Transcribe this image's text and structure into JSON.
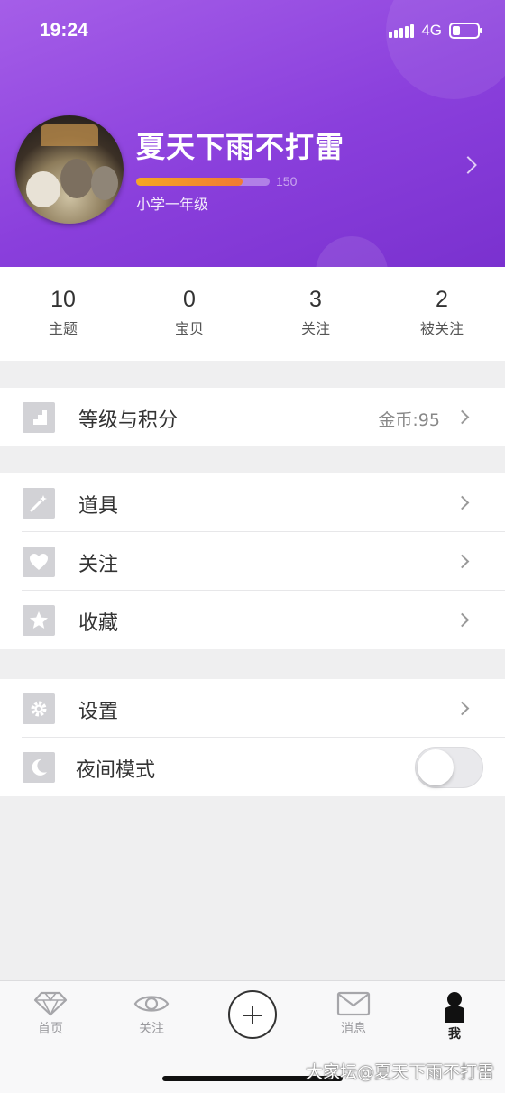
{
  "status_bar": {
    "time": "19:24",
    "network": "4G",
    "battery_level": 0.2
  },
  "profile": {
    "username": "夏天下雨不打雷",
    "level_max": "150",
    "level_progress": 0.8,
    "level_title": "小学一年级"
  },
  "stats": [
    {
      "value": "10",
      "label": "主题"
    },
    {
      "value": "0",
      "label": "宝贝"
    },
    {
      "value": "3",
      "label": "关注"
    },
    {
      "value": "2",
      "label": "被关注"
    }
  ],
  "menu": {
    "level": {
      "label": "等级与积分",
      "value": "金币:95",
      "icon": "stairs-icon"
    },
    "tools": {
      "label": "道具",
      "icon": "magic-wand-icon"
    },
    "follow": {
      "label": "关注",
      "icon": "heart-icon"
    },
    "favorites": {
      "label": "收藏",
      "icon": "star-icon"
    },
    "settings": {
      "label": "设置",
      "icon": "gear-icon"
    },
    "night_mode": {
      "label": "夜间模式",
      "icon": "moon-icon",
      "enabled": false
    }
  },
  "tabbar": {
    "home": "首页",
    "follow": "关注",
    "messages": "消息",
    "me": "我"
  },
  "colors": {
    "header_start": "#a55ee8",
    "header_end": "#7a31cf",
    "progress": "#f5a623"
  },
  "watermark": "大家坛@夏天下雨不打雷"
}
